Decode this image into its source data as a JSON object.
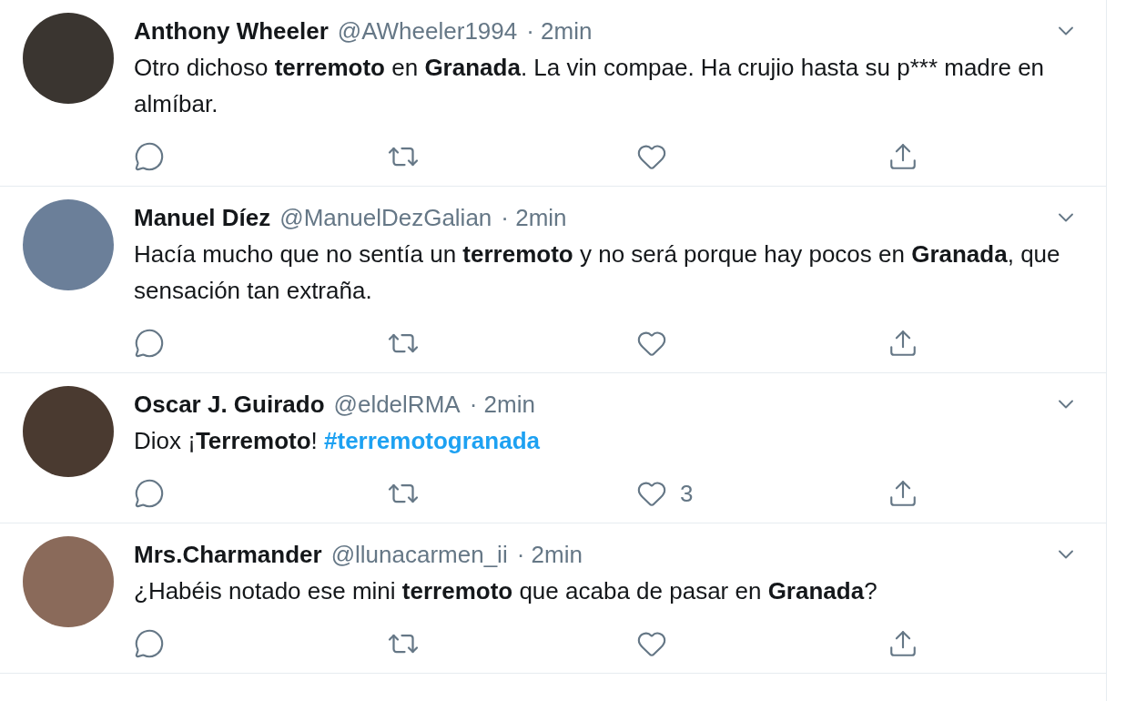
{
  "tweets": [
    {
      "name": "Anthony Wheeler",
      "handle": "@AWheeler1994",
      "time": "· 2min",
      "text": "Otro dichoso **terremoto** en **Granada**. La vin compae. Ha crujio hasta su p*** madre en almíbar."
    },
    {
      "name": "Manuel Díez",
      "handle": "@ManuelDezGalian",
      "time": "· 2min",
      "text": "Hacía mucho que no sentía un **terremoto** y no será porque hay pocos en **Granada**, que sensación tan extraña."
    },
    {
      "name": "Oscar J. Guirado",
      "handle": "@eldelRMA",
      "time": "· 2min",
      "text": "Diox ¡**Terremoto**!",
      "hashtag": "#terremotogranada",
      "likes": "3"
    },
    {
      "name": "Mrs.Charmander",
      "handle": "@llunacarmen_ii",
      "time": "· 2min",
      "text": "¿Habéis notado ese mini **terremoto** que acaba de pasar en **Granada**?"
    }
  ]
}
